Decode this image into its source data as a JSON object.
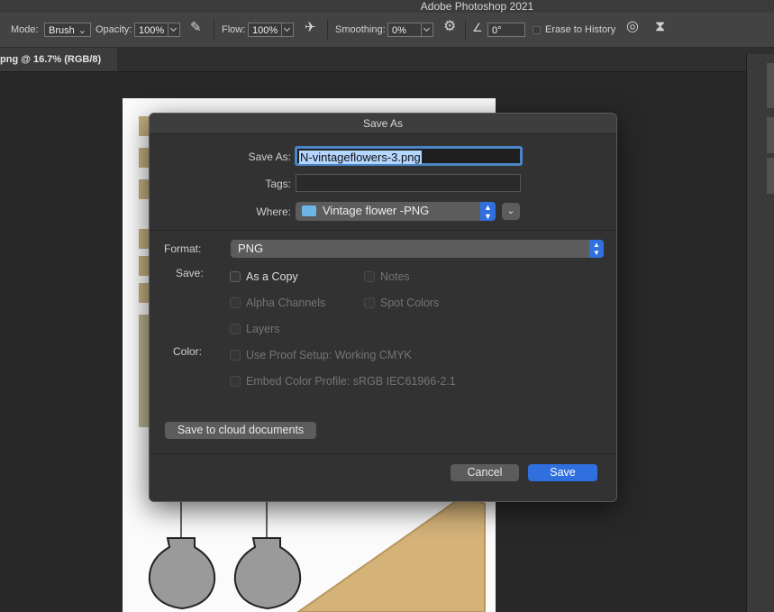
{
  "app": {
    "title": "Adobe Photoshop 2021"
  },
  "options_bar": {
    "mode_label": "Mode:",
    "mode_value": "Brush",
    "opacity_label": "Opacity:",
    "opacity_value": "100%",
    "flow_label": "Flow:",
    "flow_value": "100%",
    "smoothing_label": "Smoothing:",
    "smoothing_value": "0%",
    "angle_value": "0°",
    "erase_to_history_label": "Erase to History",
    "icons": [
      "brush-tool-icon",
      "airbrush-pressure-icon",
      "airbrush-icon",
      "gear-icon",
      "angle-icon",
      "pressure-icon",
      "symmetry-butterfly-icon"
    ]
  },
  "document_tab": {
    "title": "png @ 16.7% (RGB/8)"
  },
  "dialog": {
    "title": "Save As",
    "save_as_label": "Save As:",
    "filename": "N-vintageflowers-3.png",
    "tags_label": "Tags:",
    "tags_value": "",
    "where_label": "Where:",
    "where_value": "Vintage flower -PNG",
    "format_label": "Format:",
    "format_value": "PNG",
    "save_label": "Save:",
    "color_label": "Color:",
    "options": {
      "as_a_copy": "As a Copy",
      "notes": "Notes",
      "alpha_channels": "Alpha Channels",
      "spot_colors": "Spot Colors",
      "layers": "Layers",
      "use_proof_setup": "Use Proof Setup:  Working CMYK",
      "embed_color_profile": "Embed Color Profile:  sRGB IEC61966-2.1"
    },
    "cloud_button": "Save to cloud documents",
    "cancel_button": "Cancel",
    "save_button": "Save"
  },
  "colors": {
    "accent": "#2f6fde",
    "panel": "#323232",
    "selection": "#b4d5ff"
  }
}
